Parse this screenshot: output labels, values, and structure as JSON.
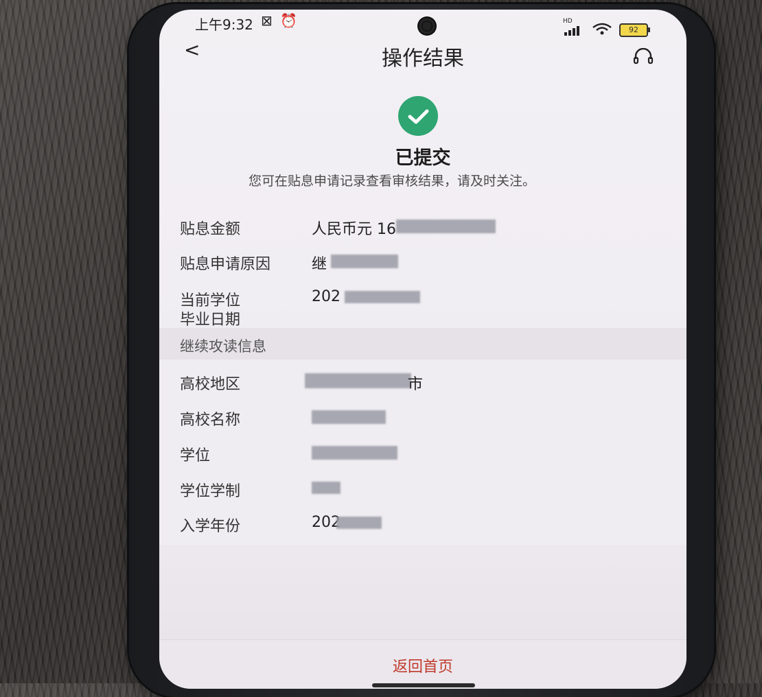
{
  "status_bar": {
    "time": "上午9:32",
    "signal": "HD",
    "battery": "92"
  },
  "header": {
    "title": "操作结果"
  },
  "result": {
    "status": "已提交",
    "message": "您可在贴息申请记录查看审核结果，请及时关注。"
  },
  "fields": {
    "amount_label": "贴息金额",
    "amount_value": "人民币元 16",
    "reason_label": "贴息申请原因",
    "reason_value": "继",
    "graduation_label_1": "当前学位",
    "graduation_label_2": "毕业日期",
    "graduation_value": "202"
  },
  "section": {
    "title": "继续攻读信息"
  },
  "study_info": {
    "region_label": "高校地区",
    "region_value": "市",
    "school_label": "高校名称",
    "degree_label": "学位",
    "duration_label": "学位学制",
    "year_label": "入学年份",
    "year_value": "202"
  },
  "footer": {
    "return_label": "返回首页"
  }
}
